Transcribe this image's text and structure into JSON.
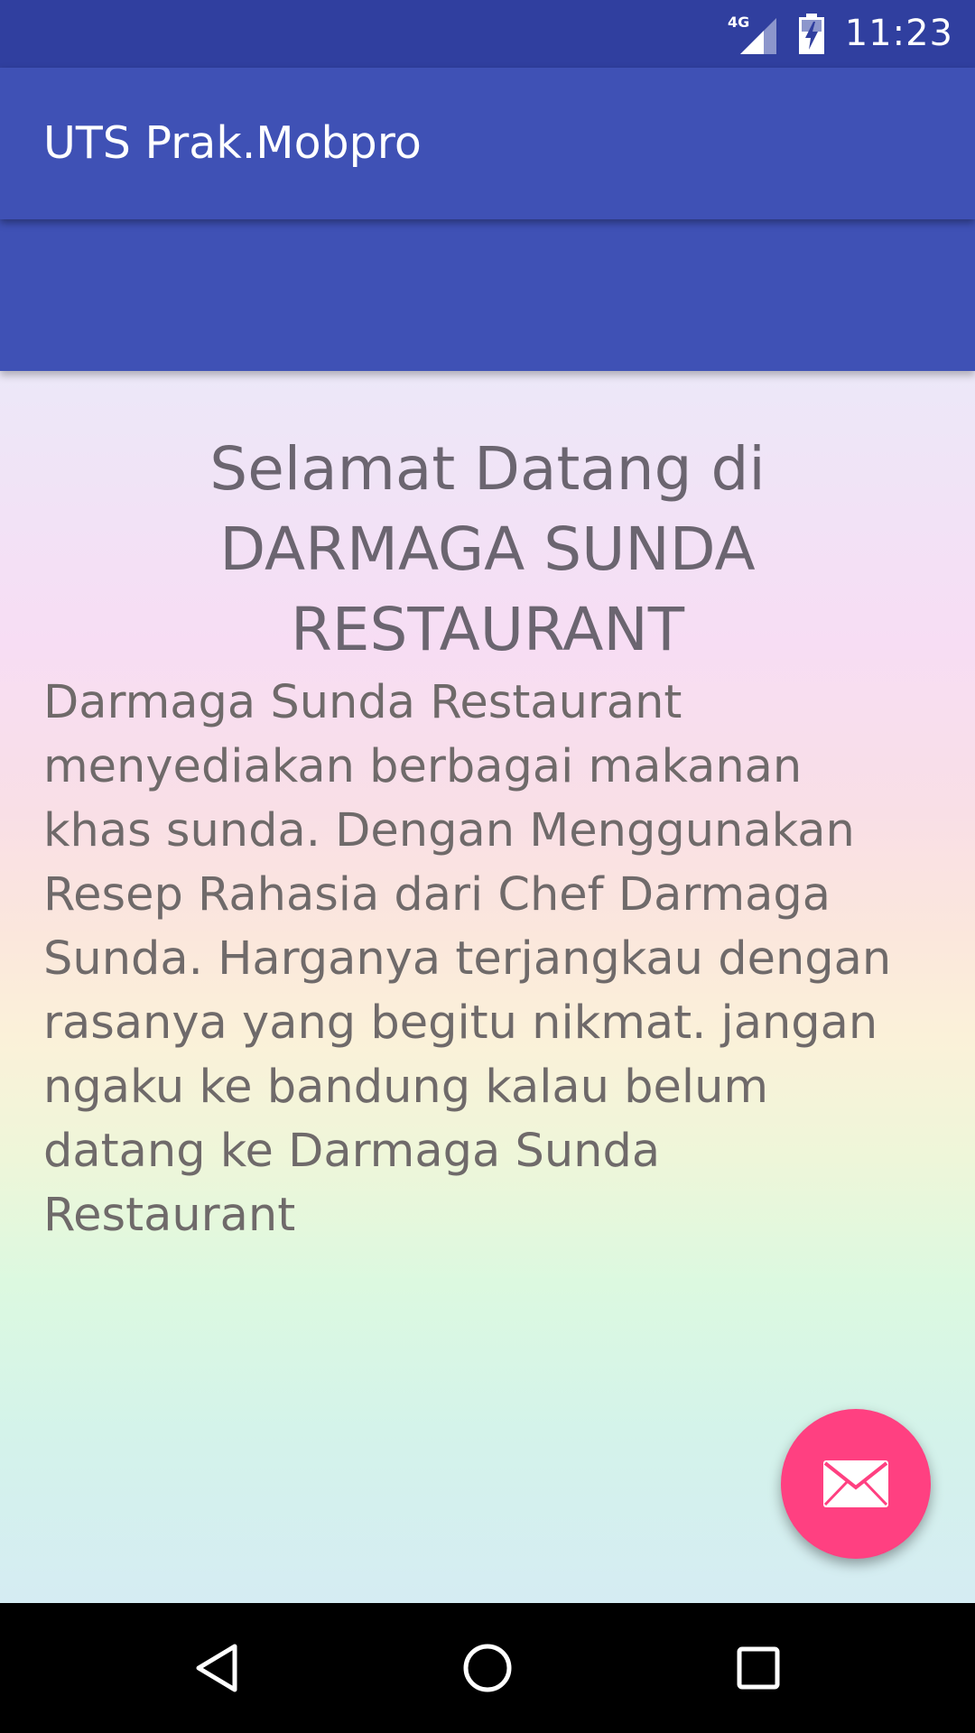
{
  "status_bar": {
    "network_label": "4G",
    "time": "11:23",
    "signal_icon": "cell-signal-icon",
    "battery_icon": "battery-charging-icon"
  },
  "app_bar": {
    "title": "UTS Prak.Mobpro"
  },
  "main": {
    "welcome_title": "Selamat Datang di\nDARMAGA SUNDA\nRESTAURANT",
    "description": "Darmaga Sunda Restaurant\nmenyediakan berbagai makanan\nkhas sunda. Dengan Menggunakan\nResep Rahasia dari Chef Darmaga\nSunda. Harganya terjangkau dengan\nrasanya yang begitu nikmat. jangan\nngaku ke bandung kalau belum\ndatang ke Darmaga Sunda\nRestaurant"
  },
  "fab": {
    "icon": "mail-icon",
    "color": "#ff4081"
  },
  "nav_bar": {
    "back_icon": "back-icon",
    "home_icon": "home-icon",
    "recents_icon": "recents-icon"
  },
  "colors": {
    "primary": "#3f51b5",
    "primary_dark": "#303f9f",
    "accent": "#ff4081"
  }
}
